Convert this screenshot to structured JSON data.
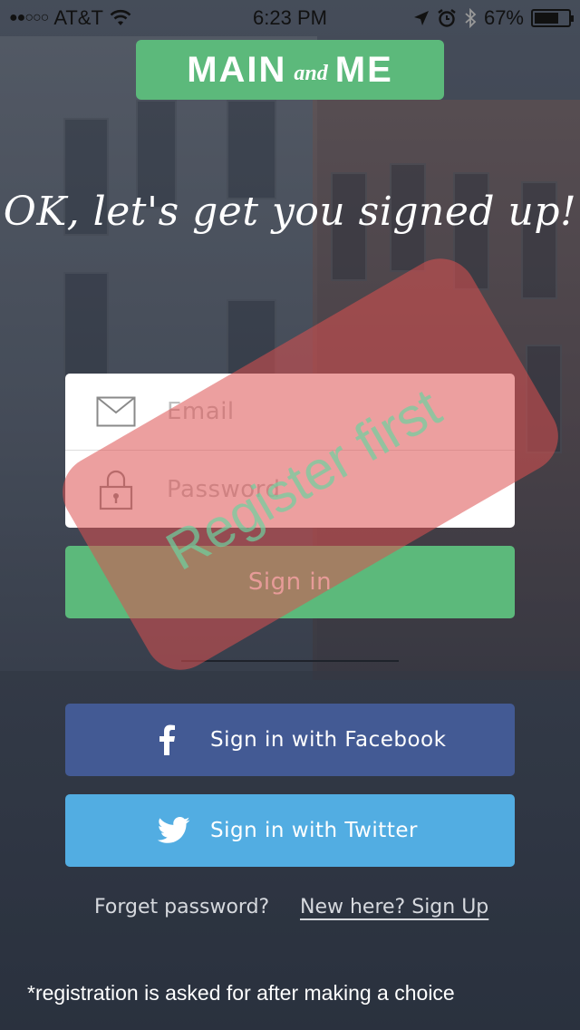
{
  "status_bar": {
    "signal": "●●○○○",
    "carrier": "AT&T",
    "time": "6:23 PM",
    "battery": "67%",
    "battery_level": 0.67
  },
  "logo": {
    "main": "MAIN",
    "and": "and",
    "me": "ME"
  },
  "headline": "OK, let's get you signed up!",
  "form": {
    "email_placeholder": "Email",
    "password_placeholder": "Password",
    "signin_label": "Sign in"
  },
  "social": {
    "facebook_label": "Sign in with Facebook",
    "twitter_label": "Sign in with Twitter"
  },
  "links": {
    "forgot": "Forget password?",
    "signup": "New here? Sign Up"
  },
  "footnote": "*registration is asked for after making a choice",
  "overlay_text": "Register first",
  "colors": {
    "brand_green": "#5cb97b",
    "facebook_blue": "#435a94",
    "twitter_blue": "#52ade2",
    "overlay_red": "#dc5050"
  },
  "icons": [
    "wifi-icon",
    "location-arrow-icon",
    "alarm-icon",
    "bluetooth-icon",
    "battery-icon",
    "envelope-icon",
    "lock-icon",
    "facebook-icon",
    "twitter-icon"
  ]
}
